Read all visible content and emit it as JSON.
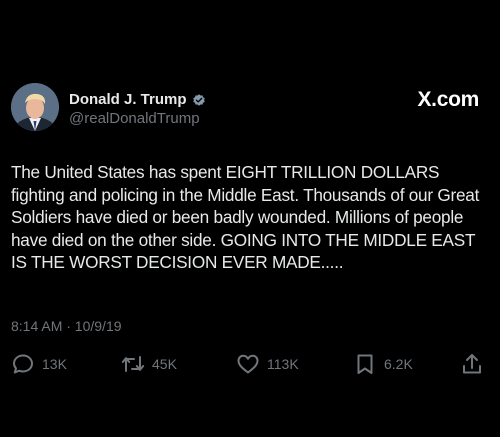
{
  "brand": {
    "label": "X.com"
  },
  "author": {
    "display_name": "Donald J. Trump",
    "handle": "@realDonaldTrump",
    "verified": true
  },
  "tweet": {
    "text": "The United States has spent EIGHT TRILLION DOLLARS fighting and policing in the Middle East. Thousands of our Great Soldiers have died or been badly wounded. Millions of people have died on the other side. GOING INTO THE MIDDLE EAST IS THE WORST DECISION EVER MADE.....",
    "timestamp": "8:14 AM · 10/9/19"
  },
  "stats": {
    "replies": "13K",
    "retweets": "45K",
    "likes": "113K",
    "bookmarks": "6.2K"
  },
  "icons": {
    "verified": "verified-badge-icon",
    "reply": "reply-icon",
    "retweet": "retweet-icon",
    "like": "heart-icon",
    "bookmark": "bookmark-icon",
    "share": "share-icon"
  },
  "colors": {
    "background": "#000000",
    "text": "#e7e9ea",
    "muted": "#71767b",
    "verified": "#829aab"
  }
}
